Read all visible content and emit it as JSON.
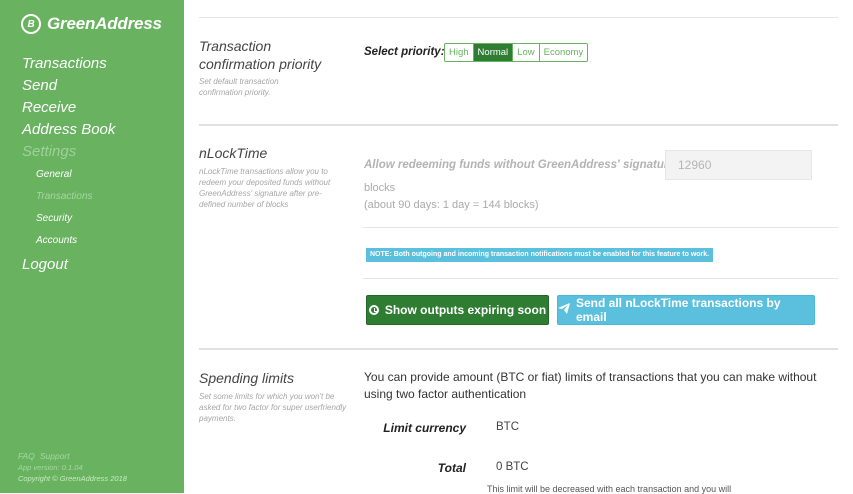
{
  "sidebar": {
    "brand": "GreenAddress",
    "brand_logo": "B",
    "nav": {
      "transactions": "Transactions",
      "send": "Send",
      "receive": "Receive",
      "address_book": "Address Book",
      "settings": "Settings",
      "logout": "Logout"
    },
    "settings_sub": {
      "general": "General",
      "transactions": "Transactions",
      "security": "Security",
      "accounts": "Accounts"
    },
    "footer": {
      "faq": "FAQ",
      "support": "Support",
      "version": "App version: 0.1.04",
      "copyright": "Copyright © GreenAddress 2018"
    }
  },
  "priority": {
    "title": "Transaction confirmation priority",
    "desc": "Set default transaction confirmation priority.",
    "label": "Select priority:",
    "options": [
      "High",
      "Normal",
      "Low",
      "Economy"
    ],
    "selected": "Normal"
  },
  "nlocktime": {
    "title": "nLockTime",
    "desc": "nLockTime transactions allow you to redeem your deposited funds without GreenAddress' signature after pre-defined number of blocks",
    "label": "Allow redeeming funds without GreenAddress' signature after",
    "value": "12960",
    "unit": "blocks",
    "hint": "(about 90 days: 1 day = 144 blocks)",
    "note": "NOTE: Both outgoing and incoming transaction notifications must be enabled for this feature to work.",
    "btn_outputs": "Show outputs expiring soon",
    "btn_email": "Send all nLockTime transactions by email"
  },
  "spending": {
    "title": "Spending limits",
    "desc": "Set some limits for which you won't be asked for two factor for super userfriendly payments.",
    "intro": "You can provide amount (BTC or fiat) limits of transactions that you can make without using two factor authentication",
    "currency_label": "Limit currency",
    "currency_value": "BTC",
    "total_label": "Total",
    "total_value": "0 BTC",
    "footer_text": "This limit will be decreased with each transaction and you will"
  },
  "colors": {
    "sidebar": "#68b260",
    "primary_dark": "#2e7d32",
    "info": "#5bc0de"
  }
}
